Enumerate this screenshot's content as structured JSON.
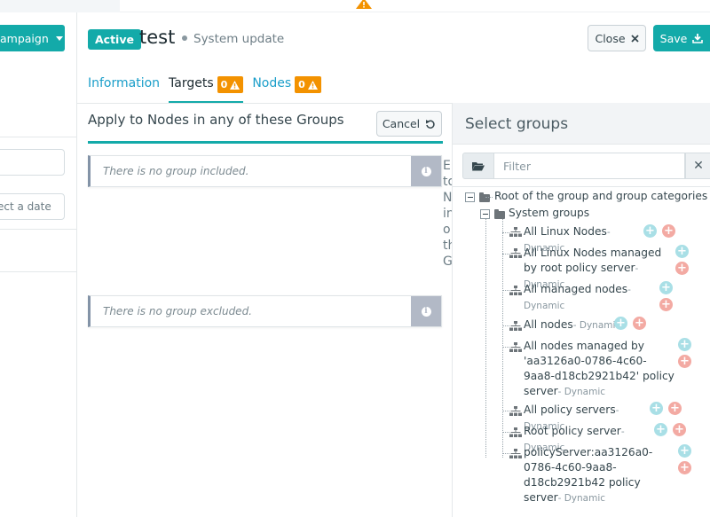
{
  "left": {
    "campaign_button": "ampaign",
    "date_placeholder": "ect a date"
  },
  "header": {
    "status_badge": "Active",
    "title": "test",
    "subtitle": "System update",
    "close_label": "Close",
    "save_label": "Save"
  },
  "tabs": [
    {
      "label": "Information",
      "badge": null
    },
    {
      "label": "Targets",
      "badge": "0"
    },
    {
      "label": "Nodes",
      "badge": "0"
    }
  ],
  "targets": {
    "heading": "Apply to Nodes in any of these Groups",
    "cancel_label": "Cancel",
    "included_empty": "There is no group included.",
    "excluded_empty": "There is no group excluded.",
    "cut_text": [
      "E",
      "to",
      "N",
      "in",
      "o",
      "th",
      "G"
    ]
  },
  "select_groups": {
    "title": "Select groups",
    "filter_placeholder": "Filter",
    "root": "Root of the group and group categories",
    "category": "System groups",
    "groups": [
      {
        "name": "All Linux Nodes",
        "tag": "- Dynamic"
      },
      {
        "name": "All Linux Nodes managed by root policy server",
        "tag": "- Dynamic"
      },
      {
        "name": "All managed nodes",
        "tag": "- Dynamic"
      },
      {
        "name": "All nodes",
        "tag": "- Dynamic"
      },
      {
        "name": "All nodes managed by 'aa3126a0-0786-4c60-9aa8-d18cb2921b42' policy server",
        "tag": "- Dynamic"
      },
      {
        "name": "All policy servers",
        "tag": "- Dynamic"
      },
      {
        "name": "Root policy server",
        "tag": "- Dynamic"
      },
      {
        "name": "policyServer:aa3126a0-0786-4c60-9aa8-d18cb2921b42 policy server",
        "tag": "- Dynamic"
      }
    ]
  },
  "colors": {
    "accent": "#13aaa9",
    "warning": "#f39200",
    "link": "#1a9ec9"
  }
}
